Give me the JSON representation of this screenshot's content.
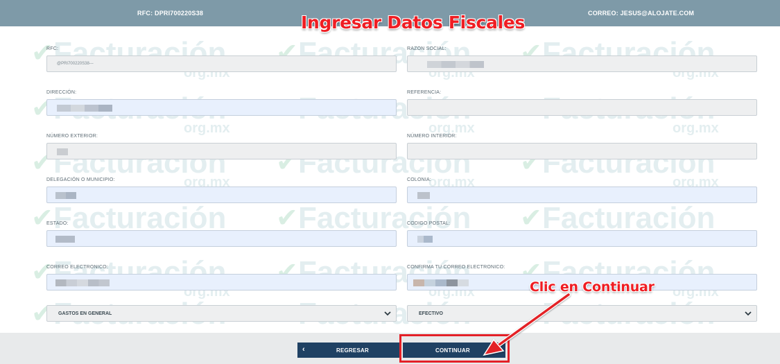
{
  "header": {
    "rfc_text": "RFC: DPRI700220S38",
    "email_text": "CORREO: JESUS@ALOJATE.COM"
  },
  "watermark": {
    "brand": "Facturación",
    "sub": "org.mx"
  },
  "annotations": {
    "title": "Ingresar Datos Fiscales",
    "click": "Clic en Continuar",
    "color": "#ef1d23"
  },
  "form": {
    "rfc": {
      "label": "RFC:",
      "value": "@PRI700220S38---"
    },
    "razon_social": {
      "label": "RAZON SOCIAL:"
    },
    "direccion": {
      "label": "DIRECCIÓN:"
    },
    "referencia": {
      "label": "REFERENCIA:"
    },
    "numero_exterior": {
      "label": "NÚMERO EXTERIOR:"
    },
    "numero_interior": {
      "label": "NÚMERO INTERIOR:"
    },
    "delegacion": {
      "label": "DELEGACIÓN O MUNICIPIO:"
    },
    "colonia": {
      "label": "COLONIA:"
    },
    "estado": {
      "label": "ESTADO:"
    },
    "codigo_postal": {
      "label": "CODIGO POSTAL:"
    },
    "correo": {
      "label": "CORREO ELECTRONICO:"
    },
    "confirma_correo": {
      "label": "CONFIRMA TU CORREO ELECTRONICO:"
    },
    "uso_cfdi": {
      "selected": "GASTOS EN GENERAL"
    },
    "forma_pago": {
      "selected": "EFECTIVO"
    }
  },
  "buttons": {
    "regresar": "REGRESAR",
    "continuar": "CONTINUAR",
    "back_glyph": "‹",
    "next_glyph": "›"
  },
  "colors": {
    "header": "#7e9aa8",
    "button": "#1f4163",
    "field_disabled": "#eeeff0",
    "field_autofill": "#e8f0fd"
  }
}
